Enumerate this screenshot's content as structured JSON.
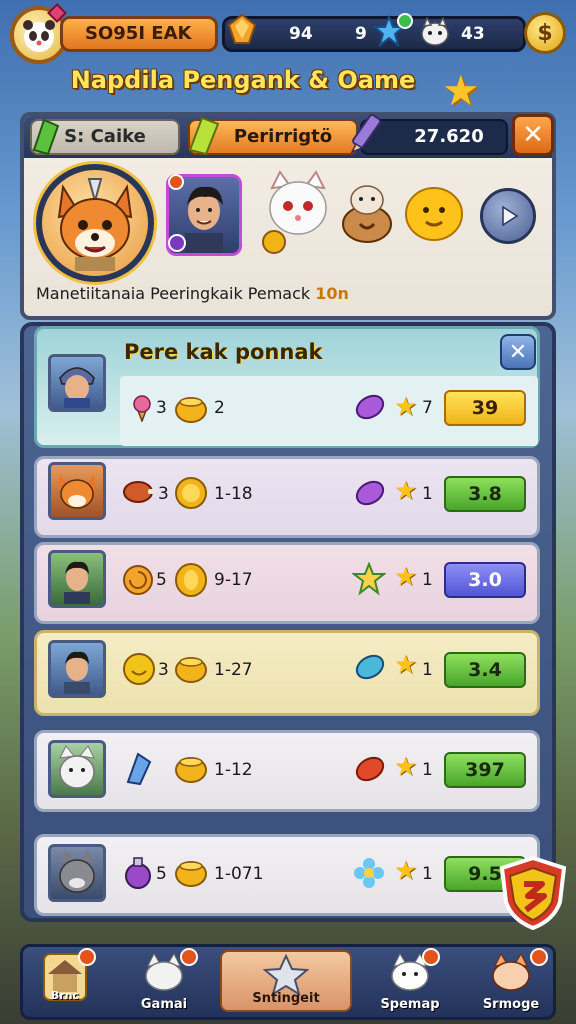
{
  "top_bar": {
    "player_name": "SO95I EAK",
    "currency_1": "94",
    "currency_2": "9",
    "currency_3": "43"
  },
  "headline": "Napdila Pengank & Oame",
  "panel": {
    "tab_1_label": "S: Caike",
    "tab_2_label": "Perirrigtö",
    "counter": "27.620",
    "caption_text": "Manetiitanaia Peeringkaik Pemack",
    "caption_value": "10n"
  },
  "list": {
    "title": "Pere kak ponnak",
    "rows": [
      {
        "count_a": "3",
        "range": "2",
        "stars": "7",
        "price": "39",
        "price_style": "yellow"
      },
      {
        "count_a": "3",
        "range": "1-18",
        "stars": "1",
        "price": "3.8",
        "price_style": "green"
      },
      {
        "count_a": "5",
        "range": "9-17",
        "stars": "1",
        "price": "3.0",
        "price_style": "blue"
      },
      {
        "count_a": "3",
        "range": "1-27",
        "stars": "1",
        "price": "3.4",
        "price_style": "green"
      },
      {
        "count_a": "",
        "range": "1-12",
        "stars": "1",
        "price": "397",
        "price_style": "green"
      },
      {
        "count_a": "5",
        "range": "1-071",
        "stars": "1",
        "price": "9.5",
        "price_style": "green"
      }
    ]
  },
  "nav": {
    "items": [
      {
        "label": "Brnc"
      },
      {
        "label": "Gamai"
      },
      {
        "label": "Sntingeit"
      },
      {
        "label": "Spemap"
      },
      {
        "label": "Srmoge"
      }
    ]
  },
  "colors": {
    "accent_orange": "#e37b22",
    "panel_navy": "#2a3658",
    "gold": "#ffc527"
  }
}
